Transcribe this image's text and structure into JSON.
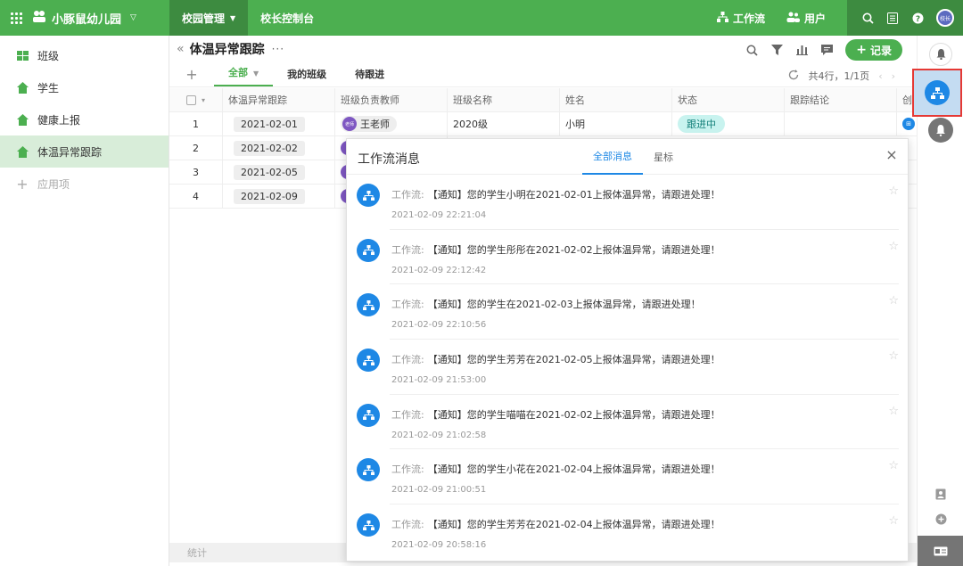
{
  "topbar": {
    "brand": "小豚鼠幼儿园",
    "tabs": [
      "校园管理",
      "校长控制台"
    ],
    "workflow_label": "工作流",
    "users_label": "用户",
    "avatar_text": "校长"
  },
  "sidebar": {
    "items": [
      {
        "label": "班级"
      },
      {
        "label": "学生"
      },
      {
        "label": "健康上报"
      },
      {
        "label": "体温异常跟踪"
      },
      {
        "label": "应用项"
      }
    ]
  },
  "main": {
    "title": "体温异常跟踪",
    "more": "···",
    "record_label": "记录",
    "views": [
      "全部",
      "我的班级",
      "待跟进"
    ],
    "pager_text": "共4行，1/1页",
    "columns": [
      "体温异常跟踪",
      "班级负责教师",
      "班级名称",
      "姓名",
      "状态",
      "跟踪结论",
      "创"
    ],
    "rows": [
      {
        "no": "1",
        "date": "2021-02-01",
        "teacher": "王老师",
        "teacher_avatar": "老师",
        "class": "2020级",
        "name": "小明",
        "status": "跟进中"
      },
      {
        "no": "2",
        "date": "2021-02-02"
      },
      {
        "no": "3",
        "date": "2021-02-05"
      },
      {
        "no": "4",
        "date": "2021-02-09"
      }
    ],
    "stat_label": "统计"
  },
  "popup": {
    "title": "工作流消息",
    "tabs": [
      "全部消息",
      "星标"
    ],
    "messages": [
      {
        "label": "工作流:",
        "text": "【通知】您的学生小明在2021-02-01上报体温异常，请跟进处理！",
        "time": "2021-02-09 22:21:04"
      },
      {
        "label": "工作流:",
        "text": "【通知】您的学生彤彤在2021-02-02上报体温异常，请跟进处理！",
        "time": "2021-02-09 22:12:42"
      },
      {
        "label": "工作流:",
        "text": "【通知】您的学生在2021-02-03上报体温异常，请跟进处理！",
        "time": "2021-02-09 22:10:56"
      },
      {
        "label": "工作流:",
        "text": "【通知】您的学生芳芳在2021-02-05上报体温异常，请跟进处理！",
        "time": "2021-02-09 21:53:00"
      },
      {
        "label": "工作流:",
        "text": "【通知】您的学生喵喵在2021-02-02上报体温异常，请跟进处理！",
        "time": "2021-02-09 21:02:58"
      },
      {
        "label": "工作流:",
        "text": "【通知】您的学生小花在2021-02-04上报体温异常，请跟进处理！",
        "time": "2021-02-09 21:00:51"
      },
      {
        "label": "工作流:",
        "text": "【通知】您的学生芳芳在2021-02-04上报体温异常，请跟进处理！",
        "time": "2021-02-09 20:58:16"
      }
    ]
  },
  "colors": {
    "brand_green": "#4caf50",
    "accent_blue": "#1e88e5",
    "highlight_red": "#e53935"
  }
}
